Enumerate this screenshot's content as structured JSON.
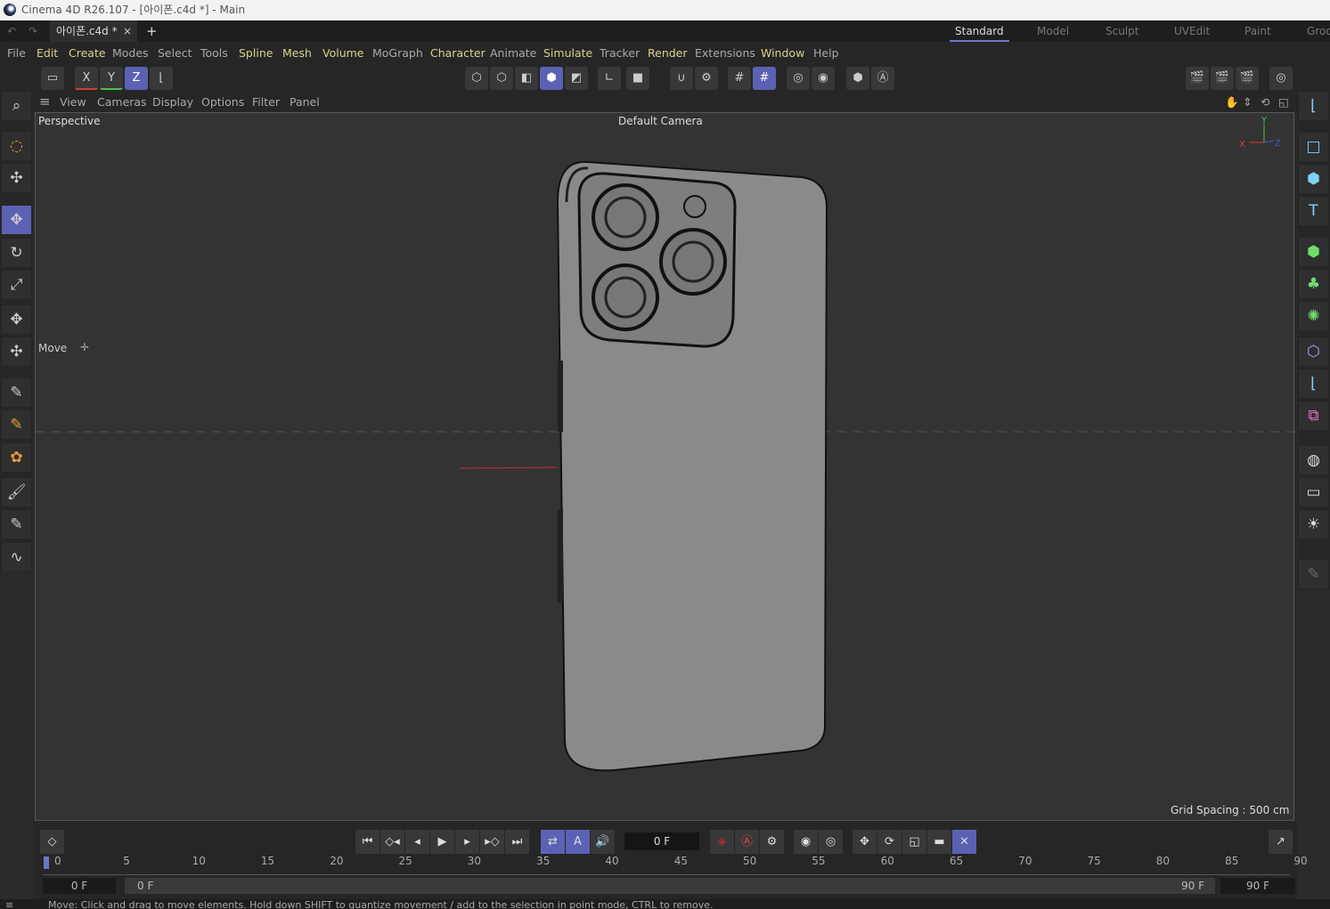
{
  "window": {
    "title": "Cinema 4D R26.107 - [아이폰.c4d *] - Main"
  },
  "tabs": {
    "doc": "아이폰.c4d *",
    "close": "×",
    "add": "+"
  },
  "layouts": [
    "Standard",
    "Model",
    "Sculpt",
    "UVEdit",
    "Paint",
    "Groo"
  ],
  "menu": [
    "File",
    "Edit",
    "Create",
    "Modes",
    "Select",
    "Tools",
    "Spline",
    "Mesh",
    "Volume",
    "MoGraph",
    "Character",
    "Animate",
    "Simulate",
    "Tracker",
    "Render",
    "Extensions",
    "Window",
    "Help"
  ],
  "axis_buttons": {
    "x": "X",
    "y": "Y",
    "z": "Z"
  },
  "viewport_menu": [
    "View",
    "Cameras",
    "Display",
    "Options",
    "Filter",
    "Panel"
  ],
  "viewport": {
    "name": "Perspective",
    "camera": "Default Camera",
    "tool_label": "Move",
    "grid_spacing": "Grid Spacing : 500 cm",
    "axes": {
      "x": "X",
      "y": "Y",
      "z": "Z"
    }
  },
  "timeline": {
    "current_frame": "0 F",
    "ticks": [
      "0",
      "5",
      "10",
      "15",
      "20",
      "25",
      "30",
      "35",
      "40",
      "45",
      "50",
      "55",
      "60",
      "65",
      "70",
      "75",
      "80",
      "85",
      "90"
    ],
    "start": "0 F",
    "range_start": "0 F",
    "range_end": "90 F",
    "end": "90 F"
  },
  "status": "Move: Click and drag to move elements. Hold down SHIFT to quantize movement / add to the selection in point mode, CTRL to remove.",
  "colors": {
    "accent": "#5b62b3",
    "viewport_bg": "#333333",
    "x_axis": "#d43b3b",
    "y_axis": "#4fbf4f",
    "z_axis": "#3b5bd4"
  }
}
